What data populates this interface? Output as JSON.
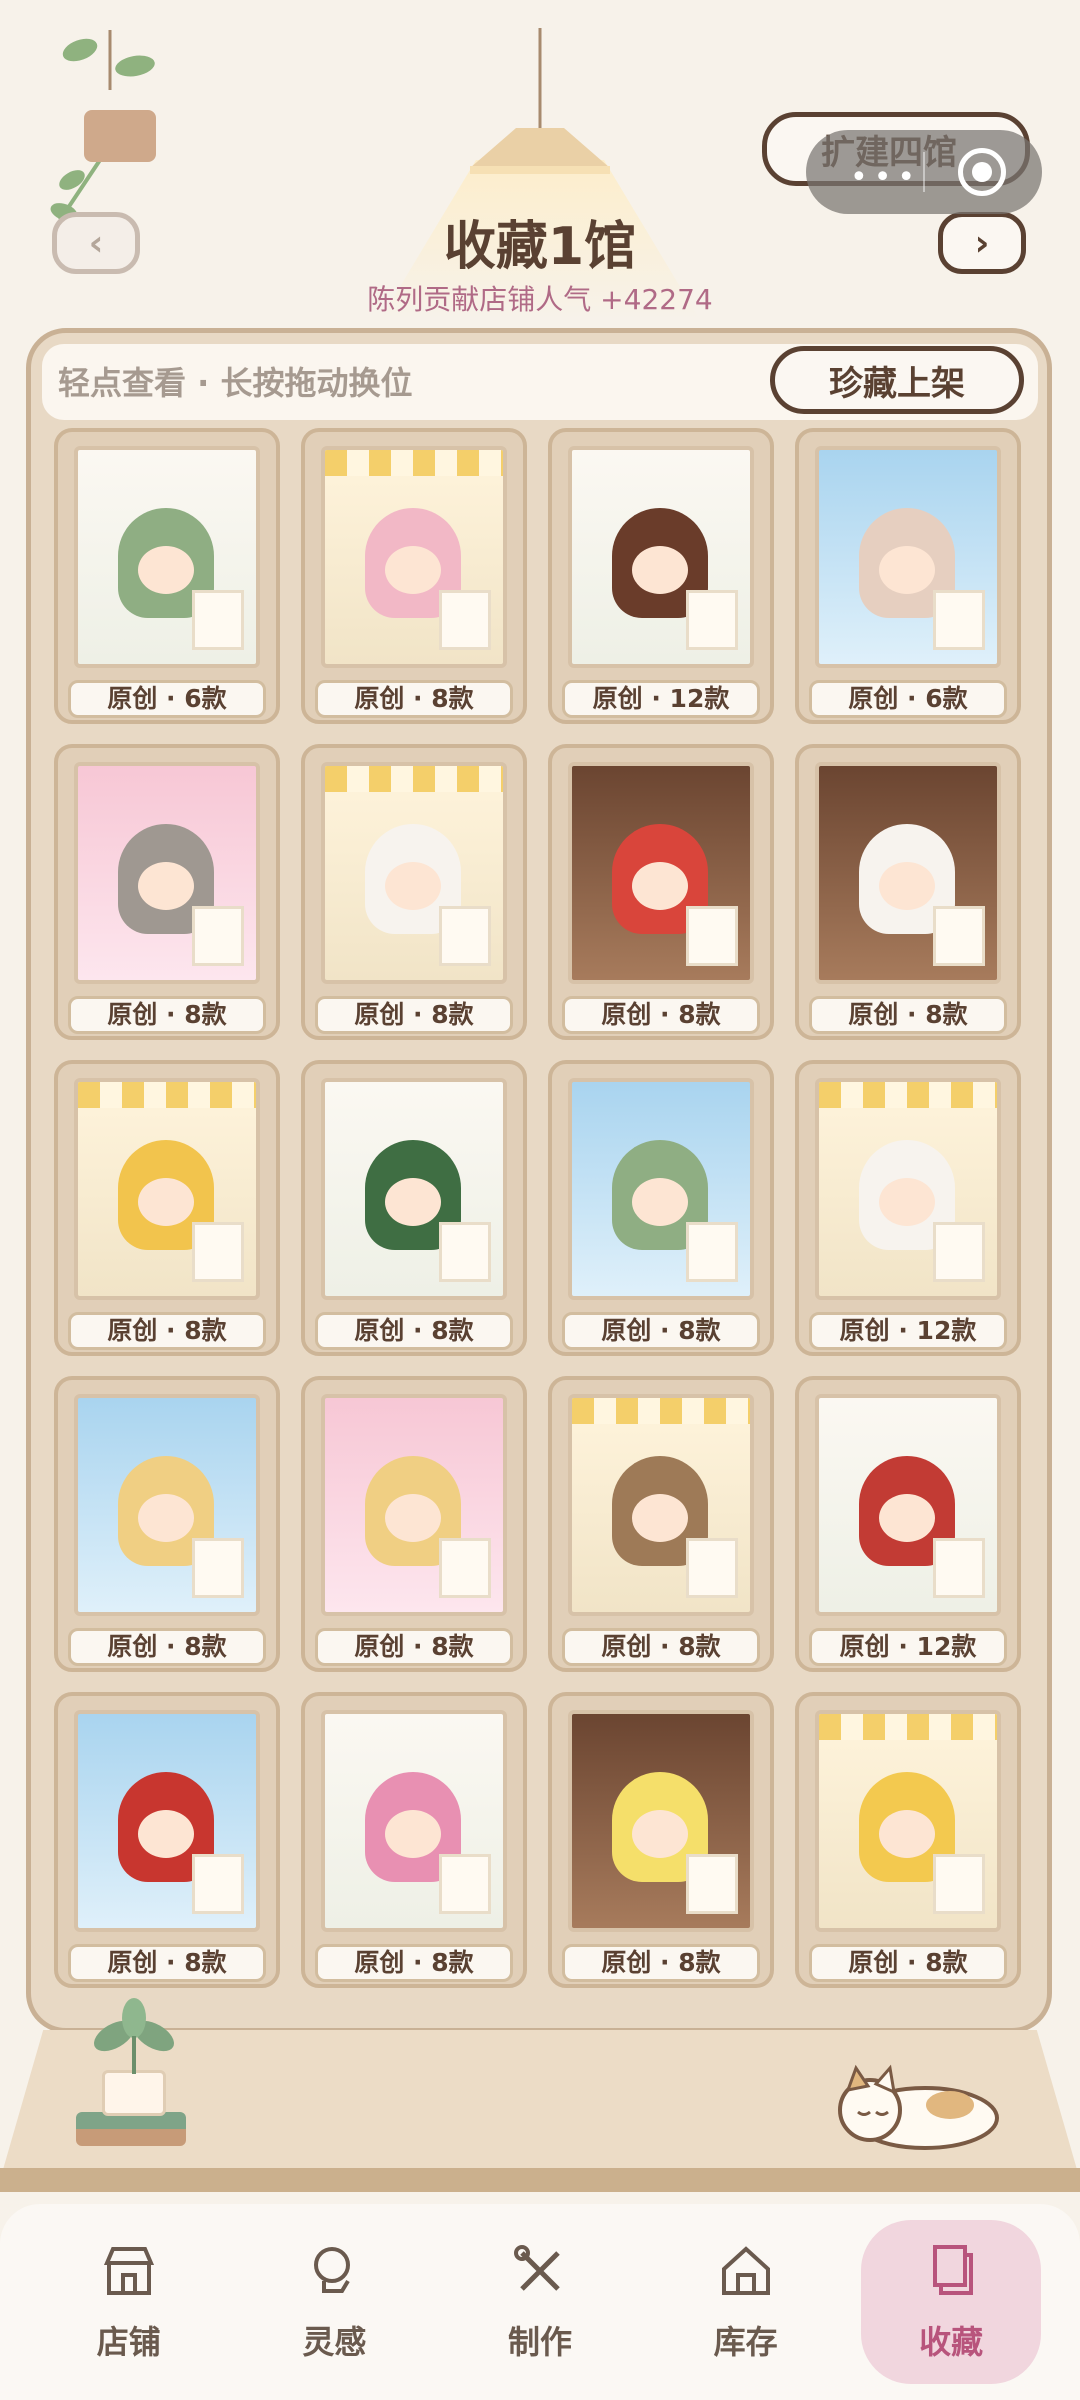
{
  "header": {
    "prev_arrow": "‹",
    "next_arrow": "›",
    "expand_button": "扩建四馆",
    "hall_title": "收藏1馆",
    "hall_subtitle": "陈列贡献店铺人气 +42274",
    "capsule_dots": "•••"
  },
  "cabinet": {
    "hint": "轻点查看 · 长按拖动换位",
    "treasure_button": "珍藏上架",
    "items": [
      {
        "label": "原创 · 6款",
        "bg": "white",
        "figure_color": "#8fae83"
      },
      {
        "label": "原创 · 8款",
        "bg": "shop",
        "figure_color": "#f2b8c6"
      },
      {
        "label": "原创 · 12款",
        "bg": "white",
        "figure_color": "#6a3c2a"
      },
      {
        "label": "原创 · 6款",
        "bg": "sky",
        "figure_color": "#e6cfc0"
      },
      {
        "label": "原创 · 8款",
        "bg": "pink",
        "figure_color": "#9f9891"
      },
      {
        "label": "原创 · 8款",
        "bg": "shop",
        "figure_color": "#f7f3ee"
      },
      {
        "label": "原创 · 8款",
        "bg": "brown",
        "figure_color": "#d9453b"
      },
      {
        "label": "原创 · 8款",
        "bg": "brown",
        "figure_color": "#f7f3ee"
      },
      {
        "label": "原创 · 8款",
        "bg": "shop",
        "figure_color": "#f2c44d"
      },
      {
        "label": "原创 · 8款",
        "bg": "white",
        "figure_color": "#3f6e43"
      },
      {
        "label": "原创 · 8款",
        "bg": "sky",
        "figure_color": "#8fae83"
      },
      {
        "label": "原创 · 12款",
        "bg": "shop",
        "figure_color": "#f7f3ee"
      },
      {
        "label": "原创 · 8款",
        "bg": "sky",
        "figure_color": "#f0cf83"
      },
      {
        "label": "原创 · 8款",
        "bg": "pink",
        "figure_color": "#f0cf83"
      },
      {
        "label": "原创 · 8款",
        "bg": "shop",
        "figure_color": "#9e7a57"
      },
      {
        "label": "原创 · 12款",
        "bg": "white",
        "figure_color": "#c23b34"
      },
      {
        "label": "原创 · 8款",
        "bg": "sky",
        "figure_color": "#c8362f"
      },
      {
        "label": "原创 · 8款",
        "bg": "white",
        "figure_color": "#e890b2"
      },
      {
        "label": "原创 · 8款",
        "bg": "brown",
        "figure_color": "#f5df6a"
      },
      {
        "label": "原创 · 8款",
        "bg": "shop",
        "figure_color": "#f3c94f"
      }
    ]
  },
  "bottom_nav": [
    {
      "label": "店铺",
      "icon": "shop-icon",
      "active": false
    },
    {
      "label": "灵感",
      "icon": "lightbulb-icon",
      "active": false
    },
    {
      "label": "制作",
      "icon": "tools-icon",
      "active": false
    },
    {
      "label": "库存",
      "icon": "house-icon",
      "active": false
    },
    {
      "label": "收藏",
      "icon": "collection-icon",
      "active": true
    }
  ],
  "colors": {
    "accent": "#b8547c",
    "text_dark": "#5a4132",
    "cabinet": "#e8d9c5"
  }
}
